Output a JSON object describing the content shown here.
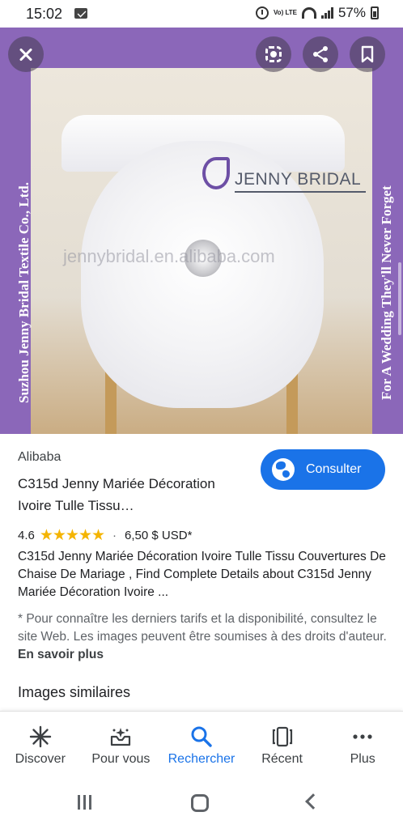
{
  "status_bar": {
    "time": "15:02",
    "network": "Vo) LTE",
    "battery": "57%"
  },
  "image": {
    "brand_text": "JENNY BRIDAL",
    "watermark": "jennybridal.en.alibaba.com",
    "left_banner": "Suzhou Jenny Bridal Textile Co., Ltd.",
    "right_banner": "For A Wedding They'll Never Forget"
  },
  "result": {
    "source": "Alibaba",
    "title": "C315d Jenny Mariée Décoration Ivoire Tulle Tissu…",
    "consult_label": "Consulter",
    "rating": "4.6",
    "stars": "★★★★★",
    "price": "6,50 $ USD*",
    "description": "C315d Jenny Mariée Décoration Ivoire Tulle Tissu Couvertures De Chaise De Mariage , Find Complete Details about C315d Jenny Mariée Décoration Ivoire ...",
    "notice": "* Pour connaître les derniers tarifs et la disponibilité, consultez le site Web. Les images peuvent être soumises à des droits d'auteur.",
    "learn_more": "En savoir plus",
    "similar_heading": "Images similaires"
  },
  "bottom_nav": [
    {
      "label": "Discover",
      "icon": "discover-asterisk-icon"
    },
    {
      "label": "Pour vous",
      "icon": "inbox-sparkle-icon"
    },
    {
      "label": "Rechercher",
      "icon": "search-icon"
    },
    {
      "label": "Récent",
      "icon": "recent-cards-icon"
    },
    {
      "label": "Plus",
      "icon": "more-dots-icon"
    }
  ],
  "colors": {
    "accent": "#1a73e8",
    "viewer_background": "#8b67b9",
    "star": "#f4b400"
  }
}
